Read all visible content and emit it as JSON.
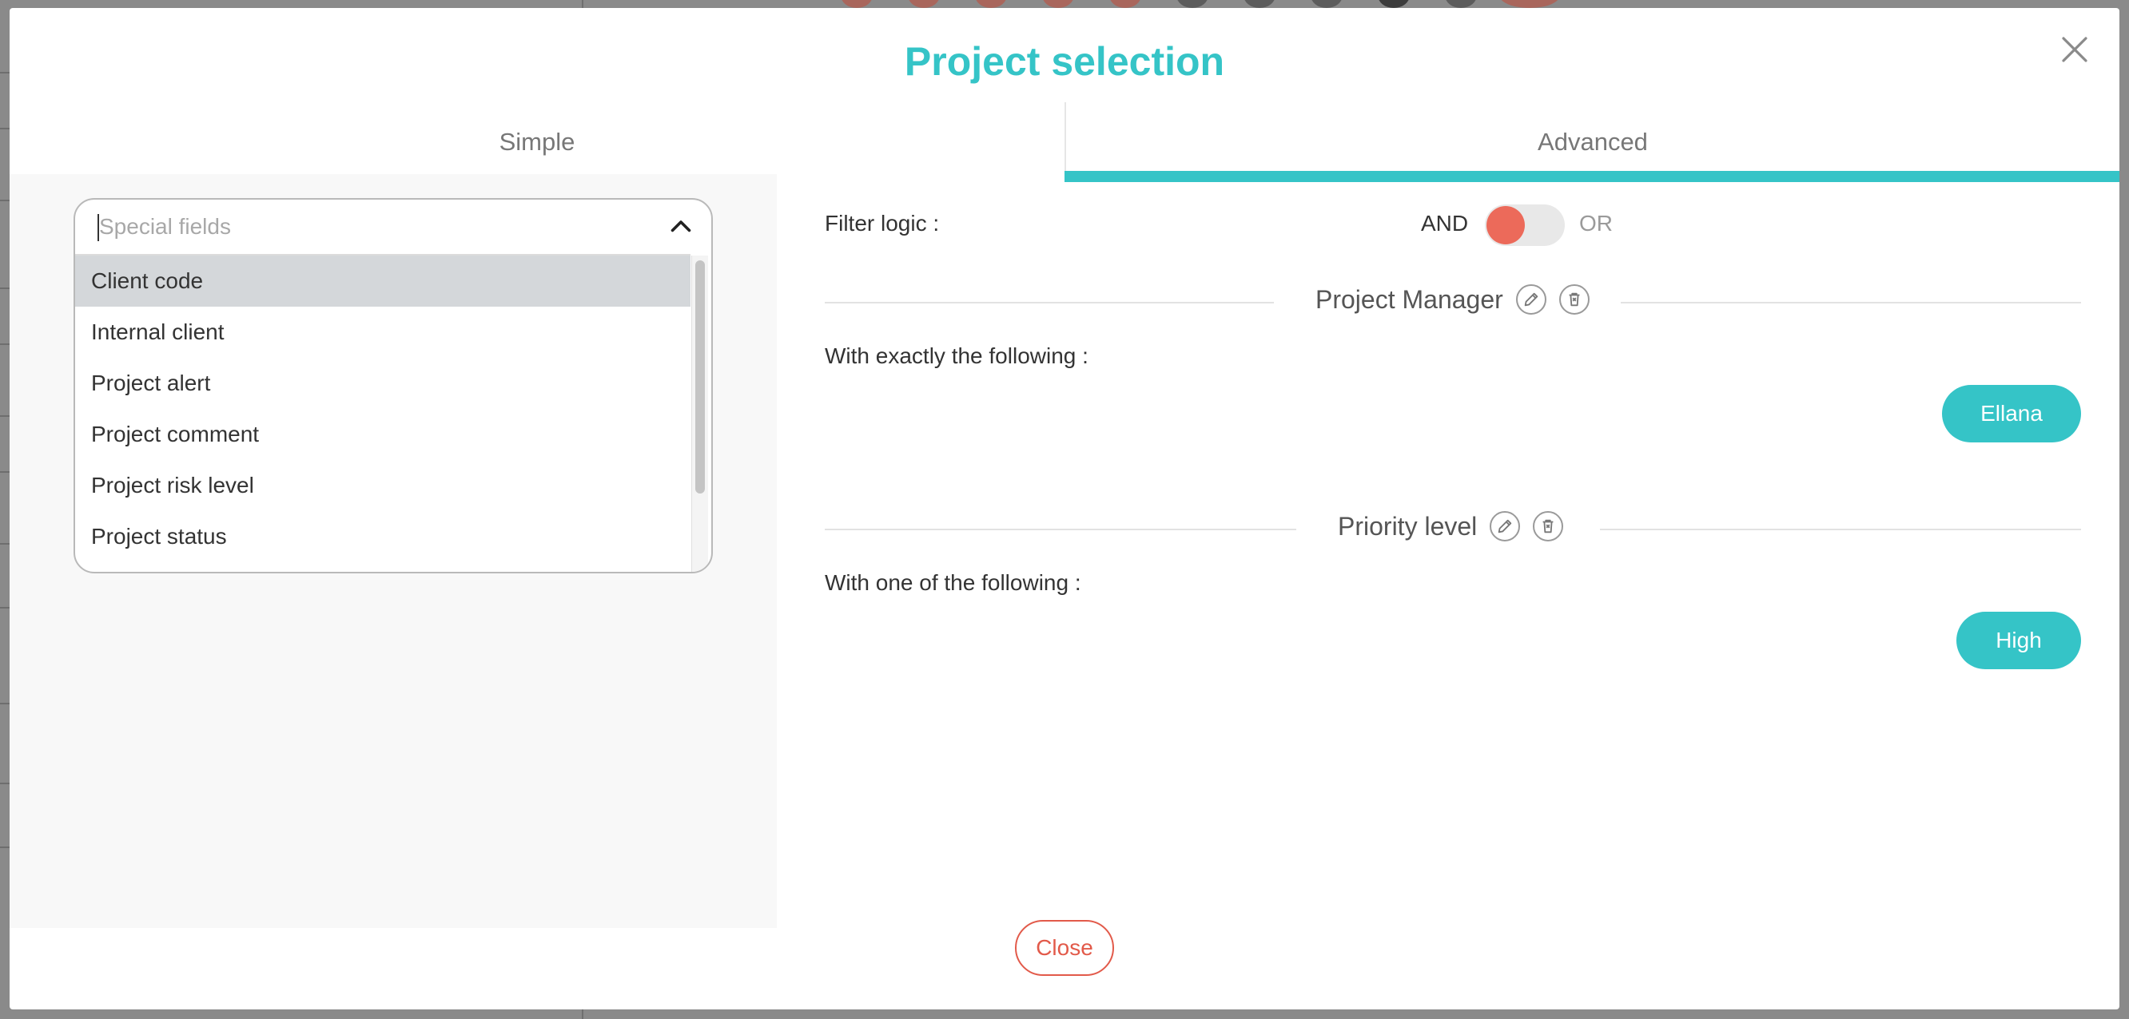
{
  "modal": {
    "title": "Project selection",
    "close_button_label": "Close",
    "close_icon": "close-icon"
  },
  "tabs": [
    {
      "label": "Simple",
      "active": false
    },
    {
      "label": "Advanced",
      "active": true
    }
  ],
  "special_fields": {
    "placeholder": "Special fields",
    "options": [
      {
        "label": "Client code",
        "highlighted": true
      },
      {
        "label": "Internal client",
        "highlighted": false
      },
      {
        "label": "Project alert",
        "highlighted": false
      },
      {
        "label": "Project comment",
        "highlighted": false
      },
      {
        "label": "Project risk level",
        "highlighted": false
      },
      {
        "label": "Project status",
        "highlighted": false
      }
    ]
  },
  "filter_logic": {
    "label": "Filter logic :",
    "and_label": "AND",
    "or_label": "OR",
    "selected": "AND"
  },
  "criteria": [
    {
      "title": "Project Manager",
      "description": "With exactly the following :",
      "values": [
        "Ellana"
      ]
    },
    {
      "title": "Priority level",
      "description": "With one of the following :",
      "values": [
        "High"
      ]
    }
  ],
  "colors": {
    "accent": "#35c4c7",
    "danger": "#e25a4a",
    "toggle_knob": "#ec6a5a"
  }
}
